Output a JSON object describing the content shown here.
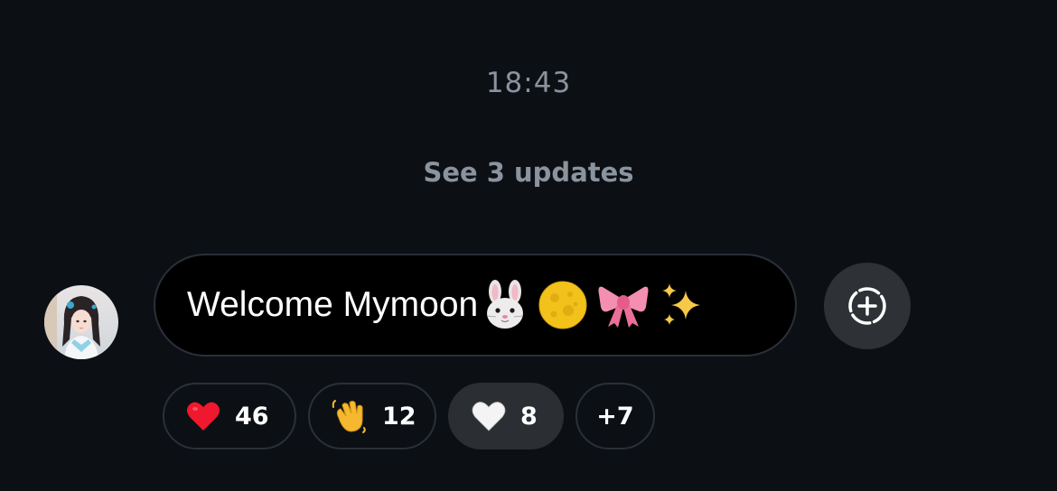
{
  "header": {
    "timestamp": "18:43",
    "see_updates": "See 3 updates"
  },
  "message": {
    "text": "Welcome Mymoon",
    "emojis": [
      "rabbit-face",
      "full-moon",
      "ribbon",
      "sparkles"
    ]
  },
  "reactions": [
    {
      "emoji": "red-heart",
      "count": "46",
      "selected": false
    },
    {
      "emoji": "waving-hand",
      "count": "12",
      "selected": false
    },
    {
      "emoji": "white-heart",
      "count": "8",
      "selected": true
    },
    {
      "emoji": "",
      "count": "+7",
      "selected": false
    }
  ],
  "icons": {
    "add_reaction": "add-reaction-icon"
  },
  "colors": {
    "background": "#0c1015",
    "muted_text": "#8b939e",
    "bubble": "#000000",
    "selected_chip": "#2b2e32"
  }
}
